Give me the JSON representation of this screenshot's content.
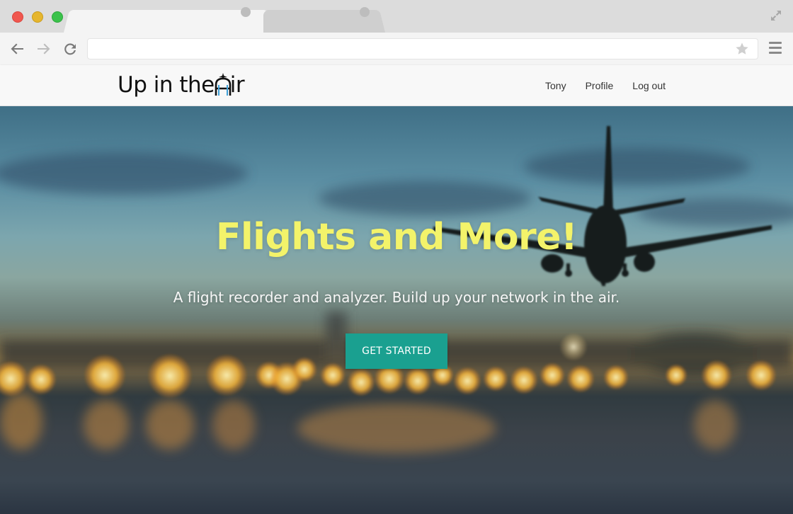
{
  "browser": {
    "address_value": "",
    "icons": [
      "back-arrow-icon",
      "forward-arrow-icon",
      "reload-icon",
      "bookmark-star-icon",
      "menu-icon",
      "fullscreen-icon"
    ]
  },
  "site": {
    "brand_prefix": "Up in the ",
    "brand_suffix": "ir",
    "nav_links": [
      "Tony",
      "Profile",
      "Log out"
    ]
  },
  "hero": {
    "title": "Flights and More!",
    "subtitle": "A flight recorder and analyzer. Build up your network in the air.",
    "cta_label": "GET STARTED"
  },
  "colors": {
    "title_yellow": "#f3f36a",
    "cta_teal": "#1aa090",
    "navbar_bg": "#f8f8f8"
  }
}
